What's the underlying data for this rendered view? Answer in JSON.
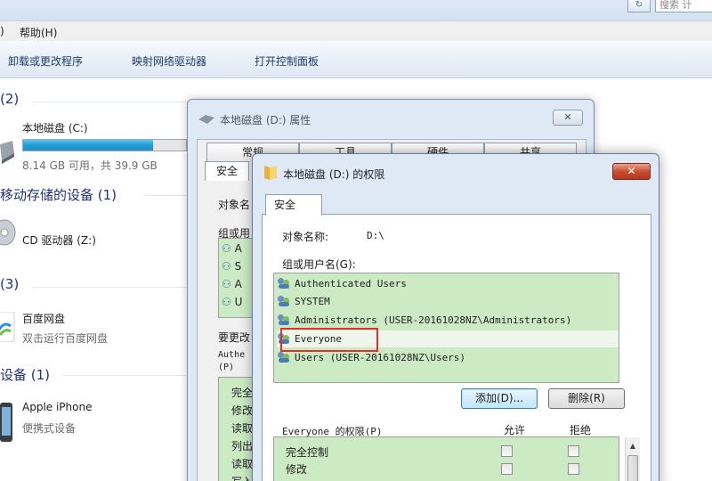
{
  "explorer": {
    "search_placeholder": "搜索 计",
    "refresh_glyph": "↻",
    "menu": {
      "prev_fragment": ")",
      "help": "帮助(H)"
    },
    "toolbar": {
      "uninstall": "卸载或更改程序",
      "map_drive": "映射网络驱动器",
      "control_panel": "打开控制面板"
    },
    "groups": {
      "hdd": {
        "title": "(2)",
        "drive_name": "本地磁盘 (C:)",
        "drive_space": "8.14 GB 可用，共 39.9 GB",
        "drive_used_fraction": 0.8
      },
      "removable": {
        "title": "移动存储的设备 (1)",
        "cd_name": "CD 驱动器 (Z:)"
      },
      "other": {
        "title": "(3)",
        "app_name": "百度网盘",
        "app_sub": "双击运行百度网盘"
      },
      "portable": {
        "title": "设备 (1)",
        "device_name": "Apple iPhone",
        "device_sub": "便携式设备"
      }
    }
  },
  "props_dialog": {
    "title": "本地磁盘 (D:) 属性",
    "close": "✕",
    "tabs": [
      "常规",
      "工具",
      "硬件",
      "共享"
    ],
    "security_tab": "安全",
    "object_label": "对象名",
    "group_label": "组或用",
    "list_rows": [
      "A",
      "S",
      "A",
      "U"
    ],
    "change_label": "要更改",
    "auth_short": "Authe",
    "p_label": "(P)",
    "perm_rows": [
      "完全",
      "修改",
      "读取",
      "列出",
      "读取",
      "写入"
    ]
  },
  "perm_dialog": {
    "title": "本地磁盘 (D:) 的权限",
    "close": "✕",
    "tab": "安全",
    "object_label": "对象名称:",
    "object_value": "D:\\",
    "group_label": "组或用户名(G):",
    "groups": [
      "Authenticated Users",
      "SYSTEM",
      "Administrators (USER-20161028NZ\\Administrators)",
      "Everyone",
      "Users (USER-20161028NZ\\Users)"
    ],
    "selected_index": 3,
    "add_button": "添加(D)...",
    "remove_button": "删除(R)",
    "perm_label": "Everyone 的权限(P)",
    "allow": "允许",
    "deny": "拒绝",
    "permissions": [
      "完全控制",
      "修改"
    ],
    "scroll_up": "▲"
  },
  "colors": {
    "highlight_box": "#e03030",
    "list_bg": "#ccebc4",
    "link": "#1e3287"
  }
}
